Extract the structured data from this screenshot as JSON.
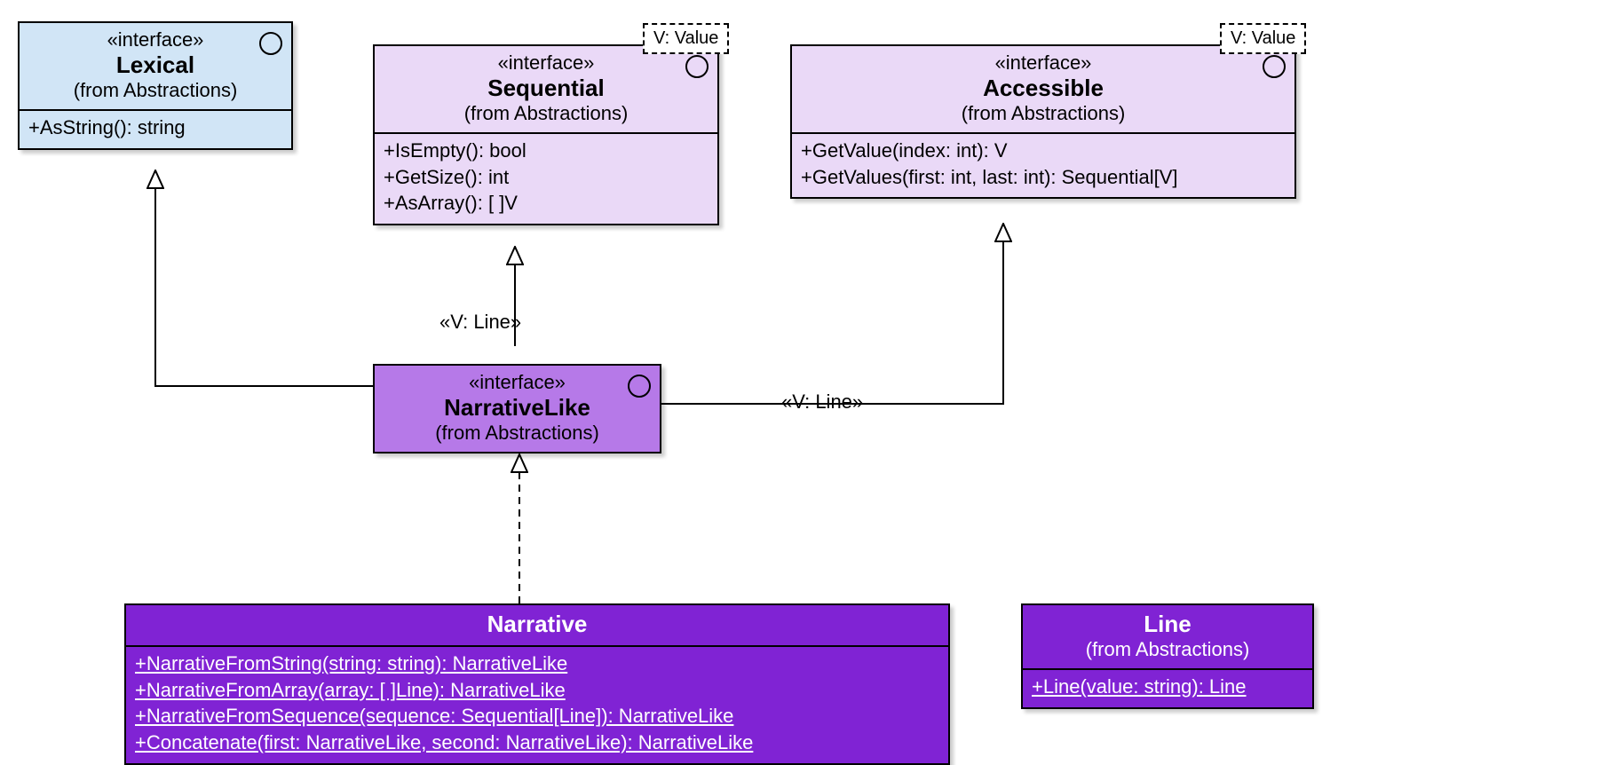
{
  "lexical": {
    "stereotype": "«interface»",
    "name": "Lexical",
    "from": "(from Abstractions)",
    "methods": [
      "+AsString(): string"
    ]
  },
  "sequential": {
    "stereotype": "«interface»",
    "name": "Sequential",
    "from": "(from Abstractions)",
    "template": "V: Value",
    "methods": [
      "+IsEmpty(): bool",
      "+GetSize(): int",
      "+AsArray(): [ ]V"
    ]
  },
  "accessible": {
    "stereotype": "«interface»",
    "name": "Accessible",
    "from": "(from Abstractions)",
    "template": "V: Value",
    "methods": [
      "+GetValue(index: int): V",
      "+GetValues(first: int, last: int): Sequential[V]"
    ]
  },
  "narrativelike": {
    "stereotype": "«interface»",
    "name": "NarrativeLike",
    "from": "(from Abstractions)"
  },
  "narrative": {
    "name": "Narrative",
    "methods": [
      "+NarrativeFromString(string: string): NarrativeLike",
      "+NarrativeFromArray(array: [ ]Line): NarrativeLike",
      "+NarrativeFromSequence(sequence: Sequential[Line]): NarrativeLike",
      "+Concatenate(first: NarrativeLike, second: NarrativeLike): NarrativeLike"
    ]
  },
  "line": {
    "name": "Line",
    "from": "(from Abstractions)",
    "methods": [
      "+Line(value: string): Line"
    ]
  },
  "labels": {
    "seq_vline": "«V: Line»",
    "acc_vline": "«V: Line»"
  }
}
